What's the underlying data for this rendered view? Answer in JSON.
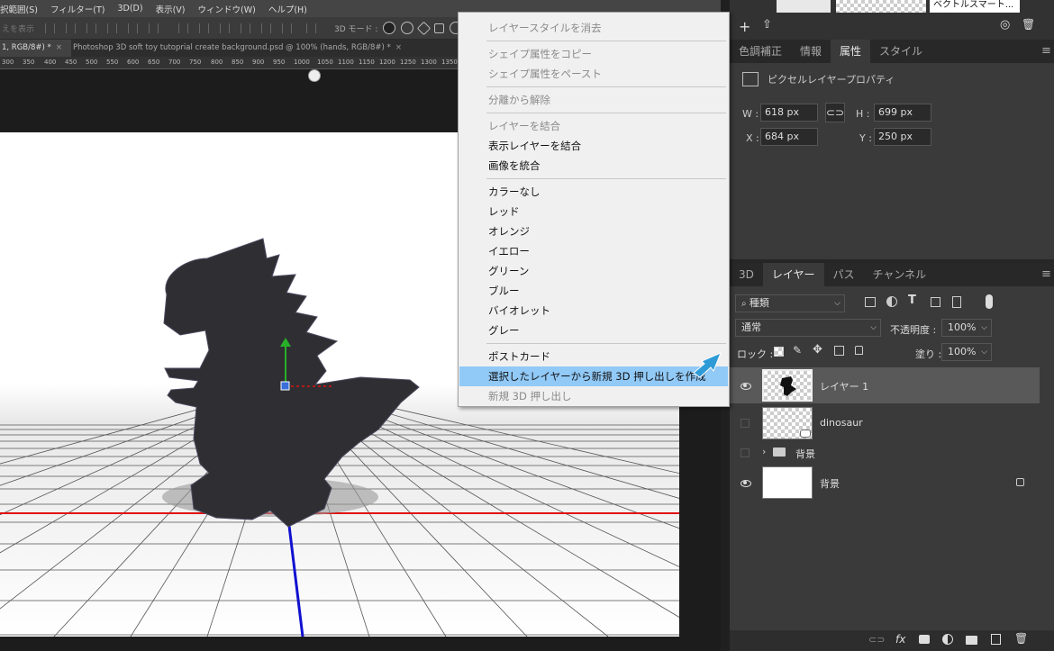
{
  "menubar": [
    "択範囲(S)",
    "フィルター(T)",
    "3D(D)",
    "表示(V)",
    "ウィンドウ(W)",
    "ヘルプ(H)"
  ],
  "optbar": {
    "left_label": "えを表示",
    "mode_label": "3D モード :"
  },
  "doc_tabs": [
    {
      "label": "1, RGB/8#) *",
      "close": "×",
      "active": true
    },
    {
      "label": "Photoshop 3D soft toy tutoprial create background.psd @ 100% (hands, RGB/8#) *",
      "close": "×",
      "active": false
    }
  ],
  "ruler": [
    "300",
    "350",
    "400",
    "450",
    "500",
    "550",
    "600",
    "650",
    "700",
    "750",
    "800",
    "850",
    "900",
    "950",
    "1000",
    "1050",
    "1100",
    "1150",
    "1200",
    "1250",
    "1300",
    "1350"
  ],
  "props": {
    "tabs": [
      "色調補正",
      "情報",
      "属性",
      "スタイル"
    ],
    "active_tab": 2,
    "title": "ピクセルレイヤープロパティ",
    "w_label": "W :",
    "w": "618 px",
    "h_label": "H :",
    "h": "699 px",
    "x_label": "X :",
    "x": "684 px",
    "y_label": "Y :",
    "y": "250 px"
  },
  "thumbs": {
    "label": "ベクトルスマート..."
  },
  "layers_panel": {
    "tabs": [
      "3D",
      "レイヤー",
      "パス",
      "チャンネル"
    ],
    "active_tab": 1,
    "filter": "種類",
    "blend": "通常",
    "opacity_label": "不透明度 :",
    "opacity": "100%",
    "lock_label": "ロック :",
    "fill_label": "塗り :",
    "fill": "100%"
  },
  "layers": [
    {
      "name": "レイヤー 1",
      "visible": true,
      "selected": true
    },
    {
      "name": "dinosaur",
      "visible": false
    },
    {
      "name": "背景",
      "visible": false,
      "group": true
    },
    {
      "name": "背景",
      "visible": true,
      "locked": true
    }
  ],
  "context_menu": [
    {
      "label": "レイヤースタイルを消去",
      "disabled": true
    },
    {
      "sep": true
    },
    {
      "label": "シェイプ属性をコピー",
      "disabled": true
    },
    {
      "label": "シェイプ属性をペースト",
      "disabled": true
    },
    {
      "sep": true
    },
    {
      "label": "分離から解除",
      "disabled": true
    },
    {
      "sep": true
    },
    {
      "label": "レイヤーを結合",
      "disabled": true
    },
    {
      "label": "表示レイヤーを結合",
      "disabled": false
    },
    {
      "label": "画像を統合",
      "disabled": false
    },
    {
      "sep": true
    },
    {
      "label": "カラーなし",
      "disabled": false
    },
    {
      "label": "レッド",
      "disabled": false
    },
    {
      "label": "オレンジ",
      "disabled": false
    },
    {
      "label": "イエロー",
      "disabled": false
    },
    {
      "label": "グリーン",
      "disabled": false
    },
    {
      "label": "ブルー",
      "disabled": false
    },
    {
      "label": "バイオレット",
      "disabled": false
    },
    {
      "label": "グレー",
      "disabled": false
    },
    {
      "sep": true
    },
    {
      "label": "ポストカード",
      "disabled": false
    },
    {
      "label": "選択したレイヤーから新規 3D 押し出しを作成",
      "disabled": false,
      "highlighted": true
    },
    {
      "label": "新規 3D 押し出し",
      "disabled": true
    }
  ],
  "colors": {
    "highlight": "#91c9f7",
    "accent_arrow": "#2f9bd6",
    "axis_red": "#e01010",
    "axis_blue": "#1010d0",
    "dino": "#2f2f33"
  }
}
